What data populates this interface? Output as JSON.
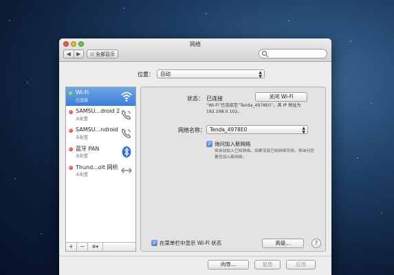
{
  "window": {
    "title": "网络"
  },
  "toolbar": {
    "back": "◀",
    "forward": "▶",
    "show_all": "全部显示",
    "search_placeholder": ""
  },
  "location": {
    "label": "位置：",
    "value": "自动"
  },
  "services": [
    {
      "name": "Wi-Fi",
      "status": "已连接",
      "dot": "green",
      "icon": "wifi-icon",
      "selected": true
    },
    {
      "name": "SAMSU...droid 2",
      "status": "未配置",
      "dot": "red",
      "icon": "phone-icon",
      "selected": false
    },
    {
      "name": "SAMSU...ndroid",
      "status": "未配置",
      "dot": "red",
      "icon": "phone-icon",
      "selected": false
    },
    {
      "name": "蓝牙 PAN",
      "status": "未配置",
      "dot": "red",
      "icon": "bluetooth-icon",
      "selected": false
    },
    {
      "name": "Thund...olt 网桥",
      "status": "未配置",
      "dot": "red",
      "icon": "bridge-icon",
      "selected": false
    }
  ],
  "sidebar_controls": {
    "add": "+",
    "remove": "−",
    "action": "✲▾"
  },
  "detail": {
    "status_label": "状态：",
    "status_value": "已连接",
    "wifi_off_button": "关闭 Wi-Fi",
    "status_description": "“Wi-Fi”已连接至“Tenda_4978E0”，其 IP 地址为 192.168.0.102。",
    "network_name_label": "网络名称：",
    "network_name_value": "Tenda_4978E0",
    "ask_join_label": "询问加入新网络",
    "ask_join_checked": true,
    "ask_join_description": "将自动加入已知网络。如果没有已知网络可用，将询问您是否加入新网络。"
  },
  "menubar_checkbox": {
    "label": "在菜单栏中显示 Wi-Fi 状态",
    "checked": true
  },
  "advanced_button": "高级...",
  "help_button": "?",
  "footer": {
    "assist": "向导...",
    "revert": "复原",
    "apply": "应用"
  },
  "colors": {
    "selection": "#3e80d7",
    "status_green": "#38a11b",
    "status_red": "#c7180e"
  }
}
